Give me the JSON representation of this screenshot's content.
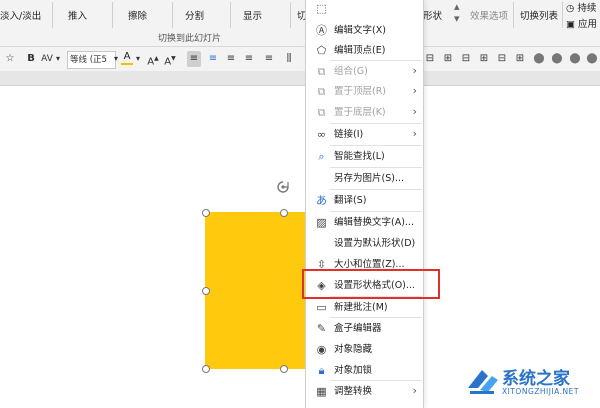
{
  "ribbon": {
    "items": [
      {
        "label": "淡入/淡出"
      },
      {
        "label": "推入"
      },
      {
        "label": "擦除"
      },
      {
        "label": "分割"
      },
      {
        "label": "显示"
      },
      {
        "label": "切"
      }
    ],
    "right_item_partial": "形状",
    "effect_options": "效果选项",
    "switch_list": "切换列表",
    "persist": "持续",
    "apply": "应用",
    "group_label": "切换到此幻灯片"
  },
  "format": {
    "bold": "B",
    "spacing": "AV",
    "font": "等线 (正5",
    "font_color": "A",
    "grow": "A",
    "shrink": "A"
  },
  "context_menu": {
    "items": [
      {
        "label": "",
        "icon": "format-a-icon"
      },
      {
        "label": "编辑文字(X)",
        "icon": "edit-text-icon"
      },
      {
        "label": "编辑顶点(E)",
        "icon": "edit-points-icon"
      },
      {
        "label": "组合(G)",
        "icon": "group-icon",
        "disabled": true,
        "submenu": true
      },
      {
        "label": "置于顶层(R)",
        "icon": "bring-front-icon",
        "disabled": true,
        "submenu": true
      },
      {
        "label": "置于底层(K)",
        "icon": "send-back-icon",
        "disabled": true,
        "submenu": true
      },
      {
        "label": "链接(I)",
        "icon": "link-icon",
        "submenu": true
      },
      {
        "label": "智能查找(L)",
        "icon": "smart-lookup-icon"
      },
      {
        "label": "另存为图片(S)...",
        "icon": ""
      },
      {
        "label": "翻译(S)",
        "icon": "translate-icon"
      },
      {
        "label": "编辑替换文字(A)...",
        "icon": "alt-text-icon"
      },
      {
        "label": "设置为默认形状(D)",
        "icon": ""
      },
      {
        "label": "大小和位置(Z)...",
        "icon": "size-position-icon"
      },
      {
        "label": "设置形状格式(O)...",
        "icon": "format-shape-icon"
      },
      {
        "label": "新建批注(M)",
        "icon": "new-comment-icon"
      },
      {
        "label": "盒子编辑器",
        "icon": "box-editor-icon"
      },
      {
        "label": "对象隐藏",
        "icon": "hide-object-icon"
      },
      {
        "label": "对象加锁",
        "icon": "lock-object-icon"
      },
      {
        "label": "调整转换",
        "icon": "adjust-convert-icon",
        "submenu": true
      }
    ]
  },
  "watermark": {
    "name": "系统之家",
    "url": "XITONGZHIJIA.NET"
  },
  "colors": {
    "shape_fill": "#ffc90e",
    "highlight": "#e0302a",
    "watermark_blue": "#2a73c9"
  }
}
